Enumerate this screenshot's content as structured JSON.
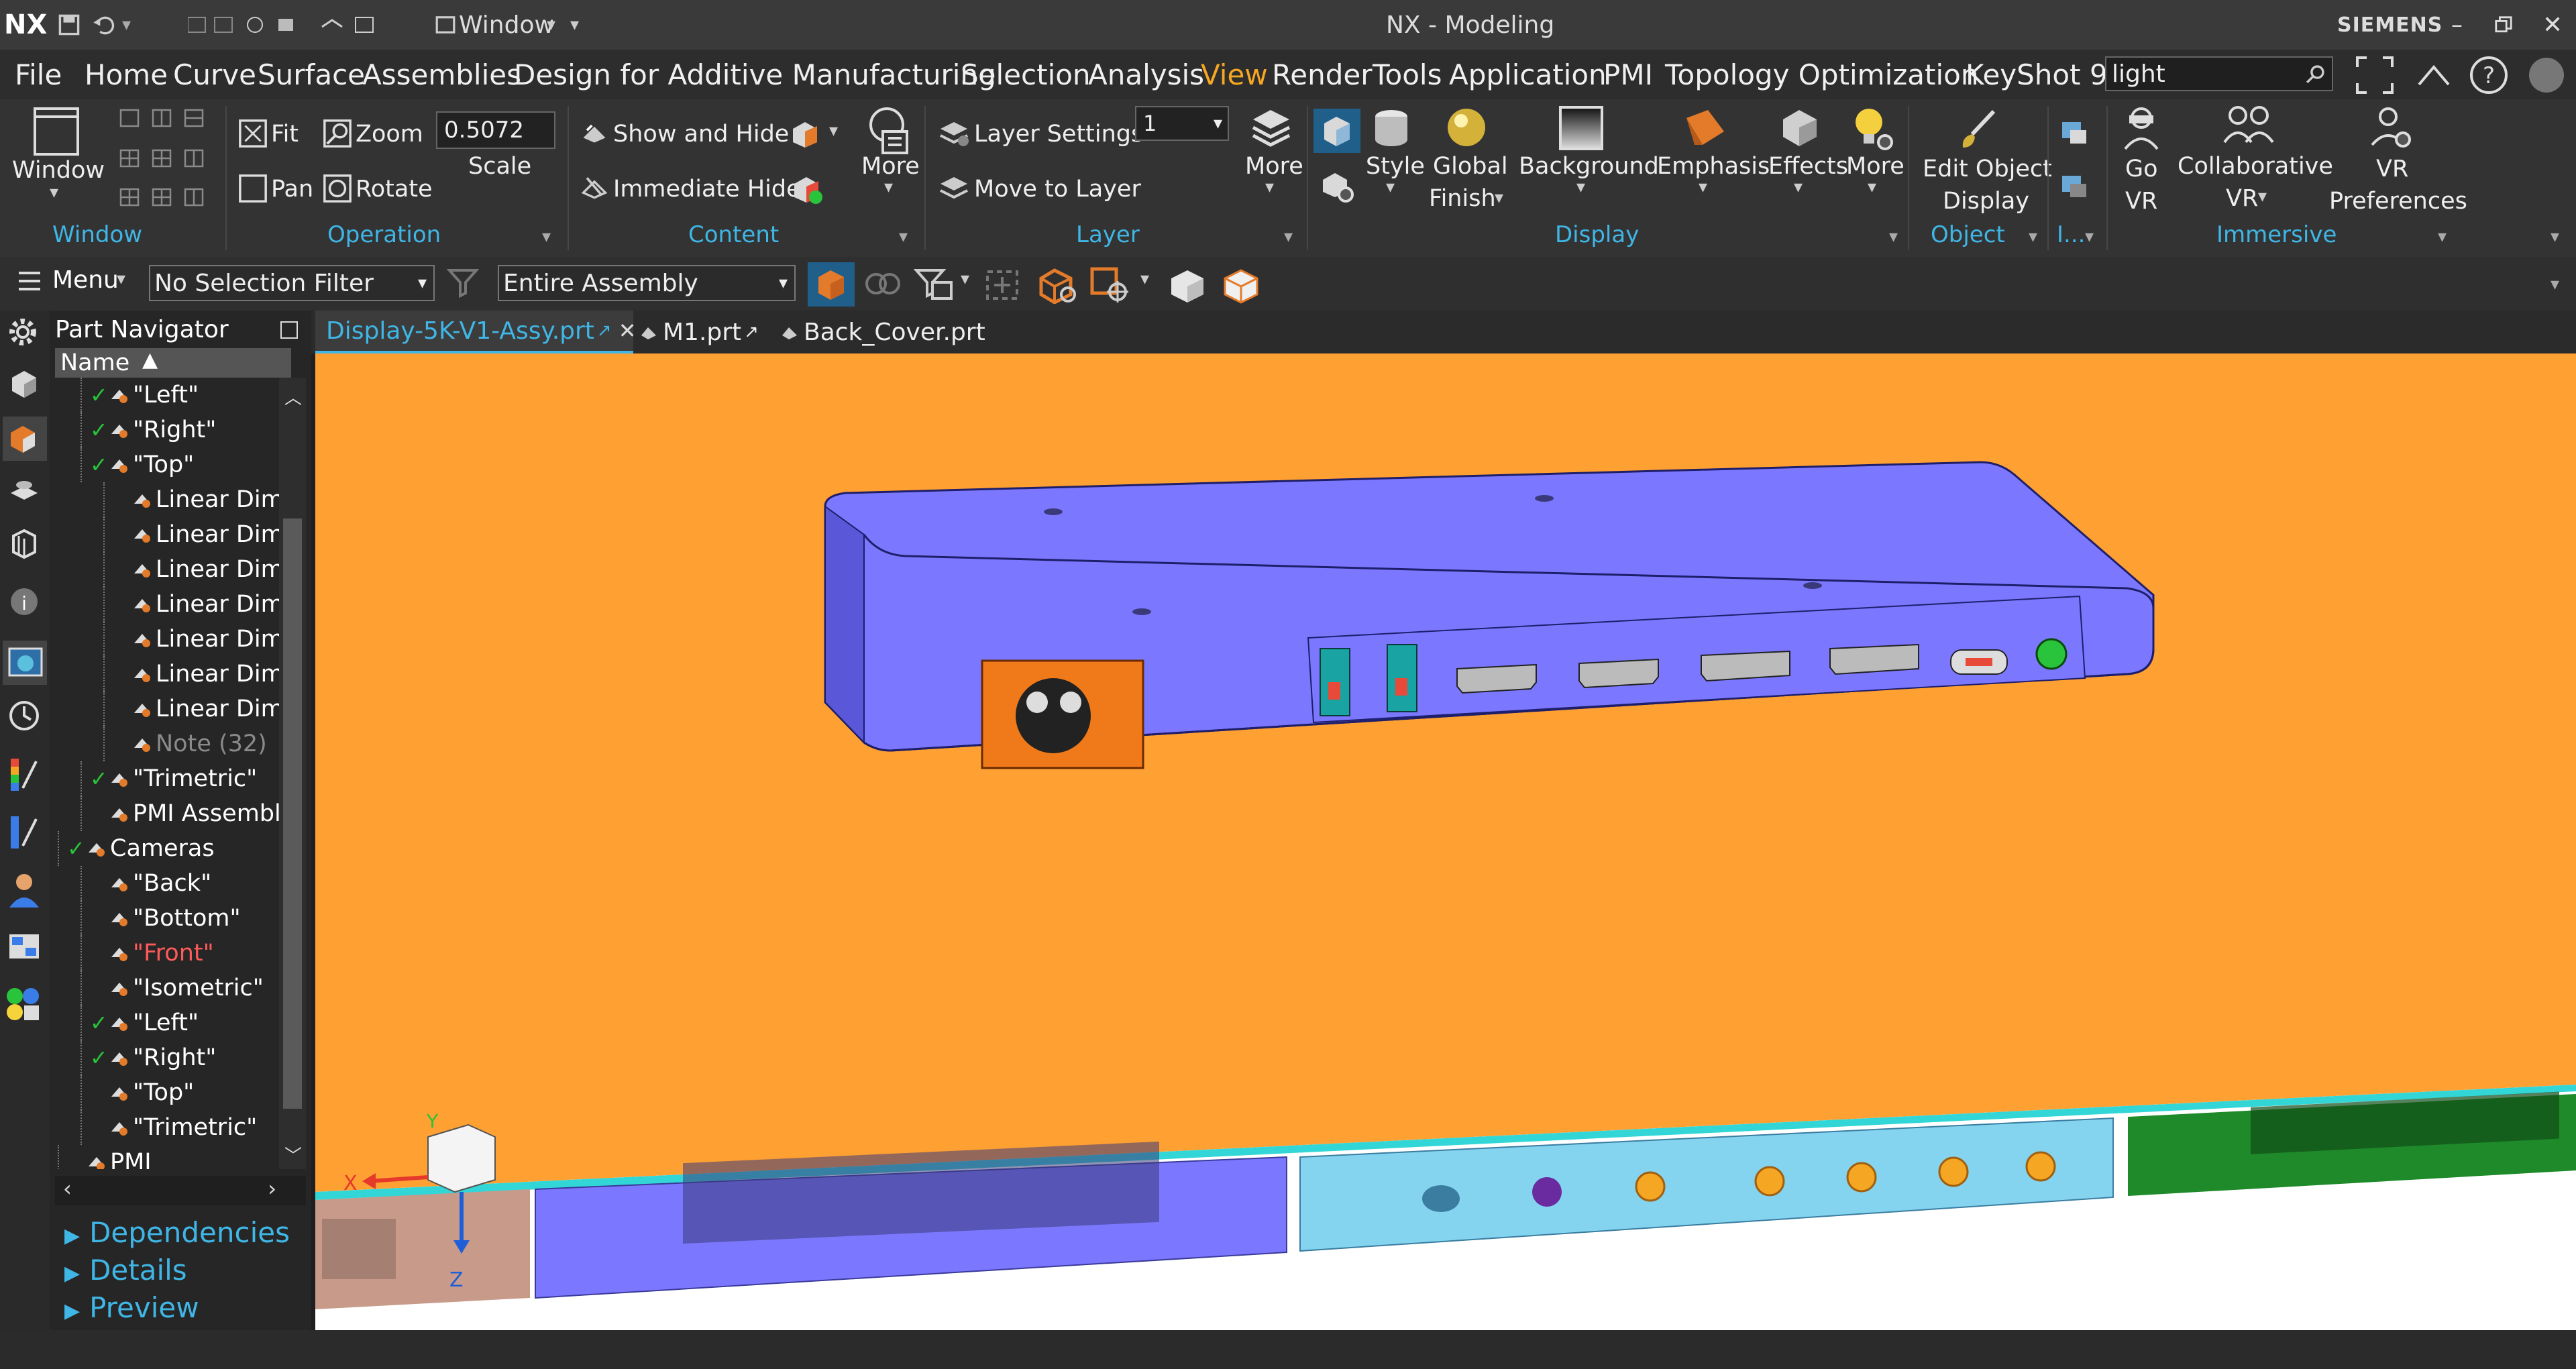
{
  "app": {
    "logo": "NX",
    "window_menu": "Window",
    "title": "NX - Modeling",
    "brand": "SIEMENS"
  },
  "menubar": {
    "items": [
      "File",
      "Home",
      "Curve",
      "Surface",
      "Assemblies",
      "Design for Additive Manufacturing",
      "Selection",
      "Analysis",
      "View",
      "Render",
      "Tools",
      "Application",
      "PMI",
      "Topology Optimization",
      "KeyShot 9"
    ],
    "active": "View",
    "search_value": "light"
  },
  "ribbon": {
    "window_btn": "Window",
    "fit": "Fit",
    "zoom": "Zoom",
    "scale_value": "0.5072",
    "scale_label": "Scale",
    "pan": "Pan",
    "rotate": "Rotate",
    "show_hide": "Show and Hide",
    "immediate_hide": "Immediate Hide",
    "more_content": "More",
    "layer_settings": "Layer Settings",
    "layer_value": "1",
    "move_to_layer": "Move to Layer",
    "more_layer": "More",
    "style": "Style",
    "global_finish_1": "Global",
    "global_finish_2": "Finish",
    "background": "Background",
    "emphasis": "Emphasis",
    "effects": "Effects",
    "more_display": "More",
    "edit_object_1": "Edit Object",
    "edit_object_2": "Display",
    "go_vr_1": "Go",
    "go_vr_2": "VR",
    "collab_1": "Collaborative",
    "collab_2": "VR",
    "vr_pref_1": "VR",
    "vr_pref_2": "Preferences",
    "groups": {
      "window": "Window",
      "operation": "Operation",
      "content": "Content",
      "layer": "Layer",
      "display": "Display",
      "object": "Object",
      "i": "I...",
      "immersive": "Immersive"
    }
  },
  "selection_bar": {
    "menu": "Menu",
    "filter": "No Selection Filter",
    "scope": "Entire Assembly"
  },
  "navigator": {
    "title": "Part Navigator",
    "column": "Name",
    "rows": [
      {
        "label": "\"Left\"",
        "check": true,
        "indent": 1,
        "color": "#ffffff"
      },
      {
        "label": "\"Right\"",
        "check": true,
        "indent": 1,
        "color": "#ffffff"
      },
      {
        "label": "\"Top\"",
        "check": true,
        "indent": 1,
        "color": "#ffffff"
      },
      {
        "label": "Linear Dim",
        "check": false,
        "indent": 2,
        "color": "#ffffff"
      },
      {
        "label": "Linear Dim",
        "check": false,
        "indent": 2,
        "color": "#ffffff"
      },
      {
        "label": "Linear Dim",
        "check": false,
        "indent": 2,
        "color": "#ffffff"
      },
      {
        "label": "Linear Dim",
        "check": false,
        "indent": 2,
        "color": "#ffffff"
      },
      {
        "label": "Linear Dim",
        "check": false,
        "indent": 2,
        "color": "#ffffff"
      },
      {
        "label": "Linear Dim",
        "check": false,
        "indent": 2,
        "color": "#ffffff"
      },
      {
        "label": "Linear Dim",
        "check": false,
        "indent": 2,
        "color": "#ffffff"
      },
      {
        "label": "Note (32)",
        "check": false,
        "indent": 2,
        "color": "#8a8a8a"
      },
      {
        "label": "\"Trimetric\"",
        "check": true,
        "indent": 1,
        "color": "#ffffff"
      },
      {
        "label": "PMI Assembly",
        "check": false,
        "indent": 1,
        "color": "#ffffff"
      },
      {
        "label": "Cameras",
        "check": true,
        "indent": 0,
        "color": "#ffffff"
      },
      {
        "label": "\"Back\"",
        "check": false,
        "indent": 1,
        "color": "#ffffff"
      },
      {
        "label": "\"Bottom\"",
        "check": false,
        "indent": 1,
        "color": "#ffffff"
      },
      {
        "label": "\"Front\"",
        "check": false,
        "indent": 1,
        "color": "#ff5a5a"
      },
      {
        "label": "\"Isometric\"",
        "check": false,
        "indent": 1,
        "color": "#ffffff"
      },
      {
        "label": "\"Left\"",
        "check": true,
        "indent": 1,
        "color": "#ffffff"
      },
      {
        "label": "\"Right\"",
        "check": true,
        "indent": 1,
        "color": "#ffffff"
      },
      {
        "label": "\"Top\"",
        "check": false,
        "indent": 1,
        "color": "#ffffff"
      },
      {
        "label": "\"Trimetric\"",
        "check": false,
        "indent": 1,
        "color": "#ffffff"
      },
      {
        "label": "PMI",
        "check": false,
        "indent": 0,
        "color": "#ffffff"
      }
    ],
    "sections": [
      "Dependencies",
      "Details",
      "Preview"
    ]
  },
  "tabs": [
    {
      "label": "Display-5K-V1-Assy.prt",
      "active": true
    },
    {
      "label": "M1.prt",
      "active": false
    },
    {
      "label": "Back_Cover.prt",
      "active": false
    }
  ],
  "triad": {
    "x": "X",
    "y": "Y",
    "z": "Z"
  },
  "colors": {
    "accent": "#3fb6e6",
    "active_menu": "#f5a623",
    "viewport_orange": "#ffa033",
    "housing": "#7b78ff",
    "front_strip": "#84d4f0",
    "green_strip": "#1e8a2a"
  }
}
